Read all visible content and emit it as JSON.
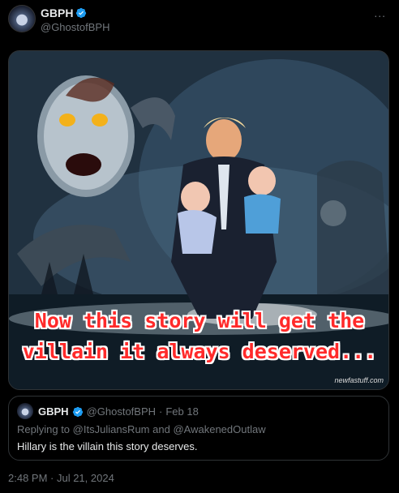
{
  "post": {
    "display_name": "GBPH",
    "handle": "@GhostofBPH",
    "more_icon": "...",
    "timestamp": "2:48 PM · Jul 21, 2024"
  },
  "image": {
    "caption_line1": "Now this story will get the",
    "caption_line2": "villain it always deserved...",
    "watermark": "newfastuff.com"
  },
  "quoted_post": {
    "display_name": "GBPH",
    "handle": "@GhostofBPH",
    "separator": "·",
    "date": "Feb 18",
    "reply_prefix": "Replying to",
    "reply_user1": "@ItsJuliansRum",
    "reply_and": "and",
    "reply_user2": "@AwakenedOutlaw",
    "text": "Hillary is the villain this story deserves."
  },
  "colors": {
    "background": "#000000",
    "verified": "#1d9bf0",
    "secondary_text": "#71767b",
    "caption_red": "#ff2a2a"
  }
}
